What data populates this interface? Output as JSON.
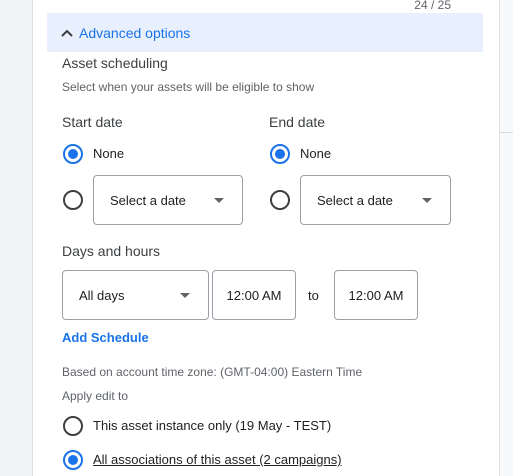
{
  "counter": "24 / 25",
  "advanced": {
    "label": "Advanced options"
  },
  "scheduling": {
    "title": "Asset scheduling",
    "subtitle": "Select when your assets will be eligible to show",
    "start": {
      "label": "Start date",
      "none_label": "None",
      "select_label": "Select a date"
    },
    "end": {
      "label": "End date",
      "none_label": "None",
      "select_label": "Select a date"
    }
  },
  "days_hours": {
    "title": "Days and hours",
    "days_value": "All days",
    "start_time": "12:00 AM",
    "to_label": "to",
    "end_time": "12:00 AM"
  },
  "add_schedule": "Add Schedule",
  "timezone_note": "Based on account time zone: (GMT-04:00) Eastern Time",
  "apply": {
    "title": "Apply edit to",
    "options": [
      {
        "label": "This asset instance only (19 May - TEST)",
        "selected": false
      },
      {
        "label": "All associations of this asset (2 campaigns)",
        "selected": true
      }
    ]
  },
  "colors": {
    "accent": "#1a73e8",
    "header_bg": "#e8f0fe"
  }
}
